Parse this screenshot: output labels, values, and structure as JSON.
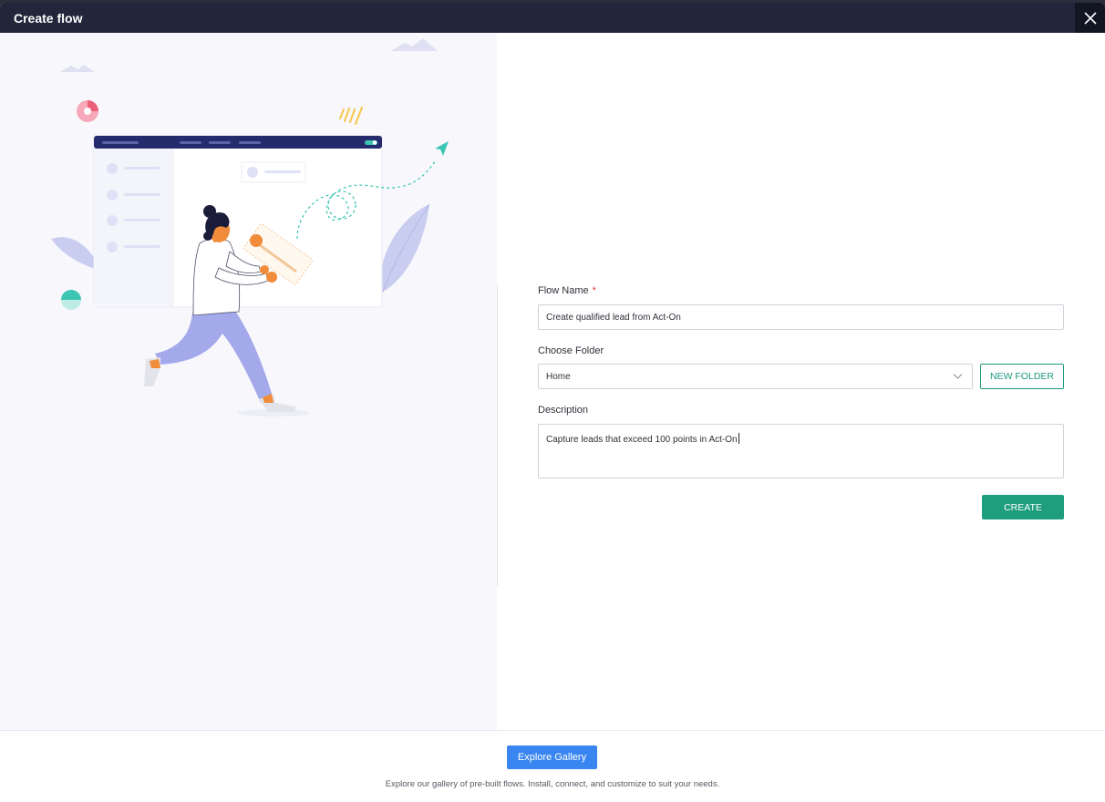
{
  "window": {
    "title": "Create flow"
  },
  "form": {
    "flow_name_label": "Flow Name",
    "required_marker": "*",
    "flow_name_value": "Create qualified lead from Act-On",
    "folder_label": "Choose Folder",
    "folder_value": "Home",
    "new_folder_label": "NEW FOLDER",
    "description_label": "Description",
    "description_value": "Capture leads that exceed 100 points in Act-On",
    "create_label": "CREATE"
  },
  "footer": {
    "gallery_button": "Explore Gallery",
    "gallery_text": "Explore our gallery of pre-built flows. Install, connect, and customize to suit your needs."
  },
  "colors": {
    "titlebar": "#21263a",
    "accent_green": "#1f9e7f",
    "gallery_blue": "#3a86f0"
  }
}
